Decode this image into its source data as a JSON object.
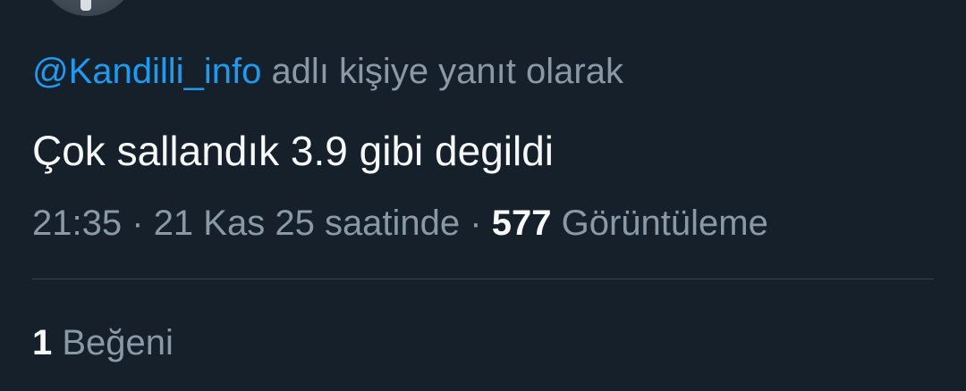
{
  "reply": {
    "handle": "@Kandilli_info",
    "suffix": "adlı kişiye yanıt olarak"
  },
  "tweet": {
    "text": "Çok sallandık 3.9 gibi degildi"
  },
  "meta": {
    "time": "21:35",
    "sep1": "·",
    "date": "21 Kas 25 saatinde",
    "sep2": "·",
    "views_count": "577",
    "views_label": "Görüntüleme"
  },
  "likes": {
    "count": "1",
    "label": "Beğeni"
  },
  "colors": {
    "background": "#15202b",
    "link": "#1d9bf0",
    "primary_text": "#f7f9f9",
    "secondary_text": "#8b98a5",
    "divider": "#38444d"
  }
}
